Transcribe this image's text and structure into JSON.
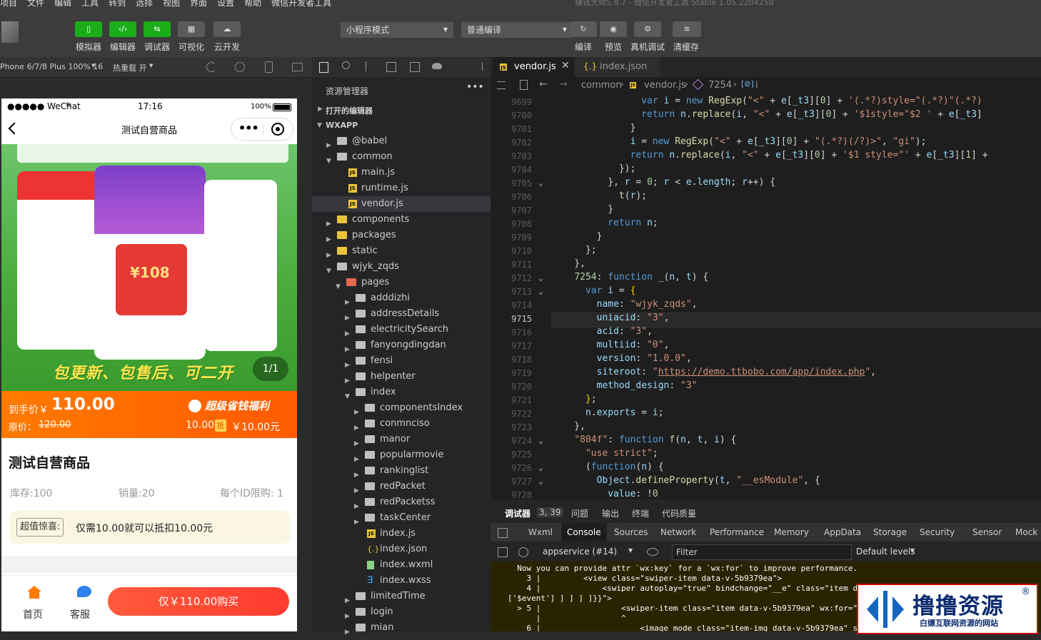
{
  "menubar": {
    "items": [
      "项目",
      "文件",
      "编辑",
      "工具",
      "转到",
      "选择",
      "视图",
      "界面",
      "设置",
      "帮助",
      "微信开发者工具"
    ],
    "title": "赚钱大师5.8.7 - 微信开发者工具 Stable 1.05.2204250"
  },
  "toolbar": {
    "buttons": [
      {
        "label": "模拟器",
        "icon": "phone-icon"
      },
      {
        "label": "编辑器",
        "icon": "code-icon"
      },
      {
        "label": "调试器",
        "icon": "debug-icon"
      },
      {
        "label": "可视化",
        "icon": "layout-icon"
      },
      {
        "label": "云开发",
        "icon": "cloud-icon"
      }
    ],
    "mode_select": "小程序模式",
    "compile_select": "普通编译",
    "actions": [
      {
        "label": "编译",
        "icon": "refresh-icon"
      },
      {
        "label": "预览",
        "icon": "eye-icon"
      },
      {
        "label": "真机调试",
        "icon": "bug-icon"
      },
      {
        "label": "清缓存",
        "icon": "layers-icon"
      }
    ]
  },
  "simbar": {
    "device": "Phone 6/7/8 Plus 100% 16",
    "hotreload": "热重载 开"
  },
  "phone": {
    "carrier": "●●●●● WeChat",
    "time": "17:16",
    "battery": "100%",
    "page_title": "测试自营商品",
    "banner_text": "包更新、包售后、可二开",
    "banner_counter": "1/1",
    "coupon": "¥108",
    "price_label": "到手价￥",
    "price": "110.00",
    "orig_label": "原价：",
    "orig_price": "120.00",
    "promo_title": "超级省钱福利",
    "promo_line_a": "10.00",
    "promo_badge": "抵",
    "promo_line_b": "￥10.00元",
    "product_name": "测试自营商品",
    "stock": "库存:100",
    "sales": "销量:20",
    "limit": "每个ID限购: 1",
    "tip_tag": "超值惊喜:",
    "tip_text": "仅需10.00就可以抵扣10.00元",
    "nav_home": "首页",
    "nav_service": "客服",
    "buy_button": "仅￥110.00购买"
  },
  "explorer": {
    "title": "资源管理器",
    "open_editors": "打开的编辑器",
    "root": "WXAPP",
    "tree": [
      {
        "name": "@babel",
        "depth": 1,
        "type": "folder",
        "open": false
      },
      {
        "name": "common",
        "depth": 1,
        "type": "folder",
        "open": true
      },
      {
        "name": "main.js",
        "depth": 2,
        "type": "js"
      },
      {
        "name": "runtime.js",
        "depth": 2,
        "type": "js"
      },
      {
        "name": "vendor.js",
        "depth": 2,
        "type": "js",
        "selected": true
      },
      {
        "name": "components",
        "depth": 1,
        "type": "folder",
        "open": false
      },
      {
        "name": "packages",
        "depth": 1,
        "type": "folder",
        "open": false
      },
      {
        "name": "static",
        "depth": 1,
        "type": "folder",
        "open": false
      },
      {
        "name": "wjyk_zqds",
        "depth": 1,
        "type": "folder",
        "open": true
      },
      {
        "name": "pages",
        "depth": 2,
        "type": "folder",
        "open": true
      },
      {
        "name": "adddizhi",
        "depth": 3,
        "type": "folder",
        "open": false
      },
      {
        "name": "addressDetails",
        "depth": 3,
        "type": "folder",
        "open": false
      },
      {
        "name": "electricitySearch",
        "depth": 3,
        "type": "folder",
        "open": false
      },
      {
        "name": "fanyongdingdan",
        "depth": 3,
        "type": "folder",
        "open": false
      },
      {
        "name": "fensi",
        "depth": 3,
        "type": "folder",
        "open": false
      },
      {
        "name": "helpenter",
        "depth": 3,
        "type": "folder",
        "open": false
      },
      {
        "name": "index",
        "depth": 3,
        "type": "folder",
        "open": true
      },
      {
        "name": "componentsIndex",
        "depth": 4,
        "type": "folder",
        "open": false
      },
      {
        "name": "conmnciso",
        "depth": 4,
        "type": "folder",
        "open": false
      },
      {
        "name": "manor",
        "depth": 4,
        "type": "folder",
        "open": false
      },
      {
        "name": "popularmovie",
        "depth": 4,
        "type": "folder",
        "open": false
      },
      {
        "name": "rankinglist",
        "depth": 4,
        "type": "folder",
        "open": false
      },
      {
        "name": "redPacket",
        "depth": 4,
        "type": "folder",
        "open": false
      },
      {
        "name": "redPacketss",
        "depth": 4,
        "type": "folder",
        "open": false
      },
      {
        "name": "taskCenter",
        "depth": 4,
        "type": "folder",
        "open": false
      },
      {
        "name": "index.js",
        "depth": 4,
        "type": "js"
      },
      {
        "name": "index.json",
        "depth": 4,
        "type": "json"
      },
      {
        "name": "index.wxml",
        "depth": 4,
        "type": "wxml"
      },
      {
        "name": "index.wxss",
        "depth": 4,
        "type": "wxss"
      },
      {
        "name": "limitedTime",
        "depth": 3,
        "type": "folder",
        "open": false
      },
      {
        "name": "login",
        "depth": 3,
        "type": "folder",
        "open": false
      },
      {
        "name": "mian",
        "depth": 3,
        "type": "folder",
        "open": false
      }
    ]
  },
  "editor": {
    "tabs": [
      {
        "label": "vendor.js",
        "active": true
      },
      {
        "label": "index.json",
        "active": false
      }
    ],
    "breadcrumb": [
      "common",
      "vendor.js",
      "7254",
      "i"
    ],
    "lines": [
      {
        "num": "9699",
        "html": "                <span class='k'>var</span> <span class='p'>i</span> = <span class='k'>new</span> <span class='f'>RegExp</span>(<span class='s'>\"&lt;\"</span> + <span class='p'>e</span>[<span class='p'>_t3</span>][<span class='n'>0</span>] + <span class='s'>'(.*?)style=\"(.*?)\"(.*?)</span>"
      },
      {
        "num": "9700",
        "html": "                <span class='k'>return</span> <span class='p'>n</span>.<span class='f'>replace</span>(<span class='p'>i</span>, <span class='s'>\"&lt;\"</span> + <span class='p'>e</span>[<span class='p'>_t3</span>][<span class='n'>0</span>] + <span class='s'>'$1style=\"$2 '</span> + <span class='p'>e</span>[<span class='p'>_t3</span>]"
      },
      {
        "num": "9701",
        "html": "              }"
      },
      {
        "num": "9702",
        "html": "              <span class='p'>i</span> = <span class='k'>new</span> <span class='f'>RegExp</span>(<span class='s'>\"&lt;\"</span> + <span class='p'>e</span>[<span class='p'>_t3</span>][<span class='n'>0</span>] + <span class='s'>\"(.*?)(/?)&gt;\"</span>, <span class='s'>\"gi\"</span>);"
      },
      {
        "num": "9703",
        "html": "              <span class='k'>return</span> <span class='p'>n</span>.<span class='f'>replace</span>(<span class='p'>i</span>, <span class='s'>\"&lt;\"</span> + <span class='p'>e</span>[<span class='p'>_t3</span>][<span class='n'>0</span>] + <span class='s'>'$1 style=\"'</span> + <span class='p'>e</span>[<span class='p'>_t3</span>][<span class='n'>1</span>] +"
      },
      {
        "num": "9704",
        "html": "            });"
      },
      {
        "num": "9705",
        "html": "          }, <span class='p'>r</span> = <span class='n'>0</span>; <span class='p'>r</span> &lt; <span class='p'>e</span>.<span class='p'>length</span>; <span class='p'>r</span>++) {"
      },
      {
        "num": "9706",
        "html": "            <span class='f'>t</span>(<span class='p'>r</span>);"
      },
      {
        "num": "9707",
        "html": "          }"
      },
      {
        "num": "9708",
        "html": "          <span class='k'>return</span> <span class='p'>n</span>;"
      },
      {
        "num": "9709",
        "html": "        }"
      },
      {
        "num": "9710",
        "html": "      };"
      },
      {
        "num": "9711",
        "html": "    },"
      },
      {
        "num": "9712",
        "html": "    <span class='n'>7254</span>: <span class='k'>function</span> <span class='f'>_</span>(<span class='p'>n</span>, <span class='p'>t</span>) {"
      },
      {
        "num": "9713",
        "html": "      <span class='k'>var</span> <span class='p'>i</span> = <span class='y'>{</span>"
      },
      {
        "num": "9714",
        "html": "        <span class='p'>name</span>: <span class='s'>\"wjyk_zqds\"</span>,"
      },
      {
        "num": "9715",
        "html": "        <span class='p'>uniacid</span>: <span class='s'>\"3\"</span>,"
      },
      {
        "num": "9716",
        "html": "        <span class='p'>acid</span>: <span class='s'>\"3\"</span>,"
      },
      {
        "num": "9717",
        "html": "        <span class='p'>multiid</span>: <span class='s'>\"0\"</span>,"
      },
      {
        "num": "9718",
        "html": "        <span class='p'>version</span>: <span class='s'>\"1.0.0\"</span>,"
      },
      {
        "num": "9719",
        "html": "        <span class='p'>siteroot</span>: <span class='s'>\"</span><span class='u'>https://demo.ttbobo.com/app/index.php</span><span class='s'>\"</span>,"
      },
      {
        "num": "9720",
        "html": "        <span class='p'>method_design</span>: <span class='s'>\"3\"</span>"
      },
      {
        "num": "9721",
        "html": "      <span class='y'>}</span>;"
      },
      {
        "num": "9722",
        "html": "      <span class='p'>n</span>.<span class='p'>exports</span> = <span class='p'>i</span>;"
      },
      {
        "num": "9723",
        "html": "    },"
      },
      {
        "num": "9724",
        "html": "    <span class='s'>\"804f\"</span>: <span class='k'>function</span> <span class='f'>f</span>(<span class='p'>n</span>, <span class='p'>t</span>, <span class='p'>i</span>) {"
      },
      {
        "num": "9725",
        "html": "      <span class='s'>\"use strict\"</span>;"
      },
      {
        "num": "9726",
        "html": "      (<span class='k'>function</span>(<span class='p'>n</span>) {"
      },
      {
        "num": "9727",
        "html": "        <span class='p'>Object</span>.<span class='f'>defineProperty</span>(<span class='p'>t</span>, <span class='s'>\"__esModule\"</span>, {"
      },
      {
        "num": "9728",
        "html": "          <span class='p'>value</span>: !<span class='n'>0</span>"
      }
    ]
  },
  "debugger": {
    "tabs": [
      "调试器",
      "3, 39",
      "问题",
      "输出",
      "终端",
      "代码质量"
    ],
    "panels": [
      "Wxml",
      "Console",
      "Sources",
      "Network",
      "Performance",
      "Memory",
      "AppData",
      "Storage",
      "Security",
      "Sensor",
      "Mock"
    ],
    "context": "appservice (#14)",
    "filter_placeholder": "Filter",
    "levels": "Default levels",
    "console_lines": [
      "  Now you can provide attr `wx:key` for a `wx:for` to improve performance.",
      "    3 |         <view class=\"swiper-item data-v-5b9379ea\">",
      "    4 |             <swiper autoplay=\"true\" bindchange=\"__e\" class=\"item dat",
      "['$event'] ] ] ] ]}}\">",
      "  > 5 |                 <swiper-item class=\"item data-v-5b9379ea\" wx:for=\"{{",
      "      |                 ^",
      "    6 |                     <image mode class=\"item-img data-v-5b9379ea\" src"
    ]
  },
  "watermark": {
    "title": "撸撸资源",
    "subtitle": "白嫖互联网资源的网站",
    "mark": "®"
  }
}
